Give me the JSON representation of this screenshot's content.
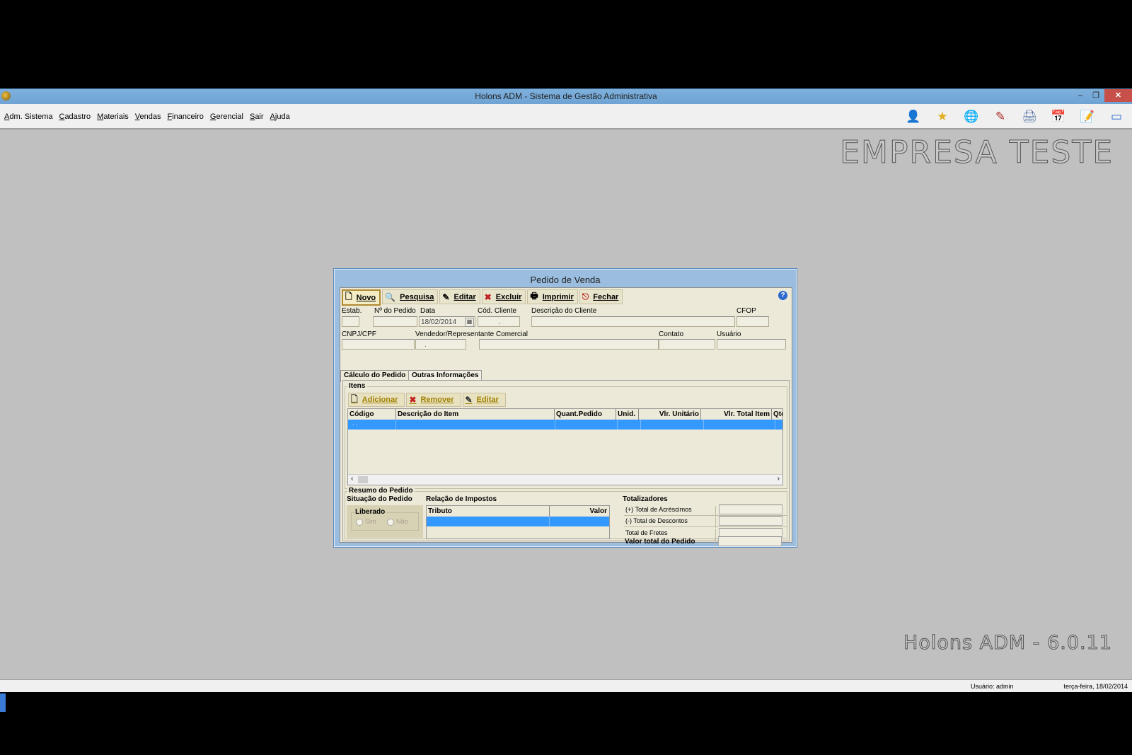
{
  "window": {
    "title": "Holons ADM - Sistema de Gestão Administrativa",
    "min_label": "–",
    "max_label": "❐",
    "close_label": "✕"
  },
  "menu": [
    "Adm. Sistema",
    "Cadastro",
    "Materiais",
    "Vendas",
    "Financeiro",
    "Gerencial",
    "Sair",
    "Ajuda"
  ],
  "toolbar_icons": [
    "user-icon",
    "star-icon",
    "globe-icon",
    "edit-document-icon",
    "printer-icon",
    "calendar-icon",
    "notes-icon",
    "windows-icon"
  ],
  "toolbar_glyphs": [
    "👤",
    "★",
    "🌐",
    "✎",
    "🖨",
    "📅",
    "📝",
    "▭"
  ],
  "background": {
    "company": "EMPRESA TESTE",
    "version": "Holons ADM - 6.0.11"
  },
  "status": {
    "user": "Usuário: admin",
    "date": "terça-feira, 18/02/2014"
  },
  "dialog": {
    "title": "Pedido de Venda",
    "toolbar": {
      "novo": "Novo",
      "pesquisa": "Pesquisa",
      "editar": "Editar",
      "excluir": "Excluir",
      "imprimir": "Imprimir",
      "fechar": "Fechar",
      "help": "?"
    },
    "fields": {
      "estab_label": "Estab.",
      "pedido_label": "Nº do Pedido",
      "data_label": "Data",
      "data_value": "18/02/2014",
      "cod_cliente_label": "Cód. Cliente",
      "cod_cliente_value": ".",
      "descricao_label": "Descrição do Cliente",
      "cfop_label": "CFOP",
      "cnpj_label": "CNPJ/CPF",
      "vendedor_label": "Vendedor/Representante Comercial",
      "vendedor_value": ".",
      "contato_label": "Contato",
      "usuario_label": "Usuário"
    },
    "tabs": [
      "Cálculo do Pedido",
      "Outras Informações"
    ],
    "itens": {
      "title": "Itens",
      "adicionar": "Adicionar",
      "remover": "Remover",
      "editar": "Editar",
      "columns": [
        "Código",
        "Descrição do Item",
        "Quant.Pedido",
        "Unid.",
        "Vlr. Unitário",
        "Vlr. Total Item",
        "Qtd"
      ],
      "first_cell": ". ."
    },
    "resumo": {
      "title": "Resumo do Pedido",
      "situacao_title": "Situação do Pedido",
      "liberado": "Liberado",
      "sim": "Sim",
      "nao": "Não",
      "impostos_title": "Relação de Impostos",
      "impostos_columns": [
        "Tributo",
        "Valor"
      ],
      "totalizadores_title": "Totalizadores",
      "acrescimos": "(+) Total de Acréscimos",
      "descontos": "(-) Total de Descontos",
      "fretes": "Total de Fretes",
      "valor_total": "Valor total do Pedido"
    }
  }
}
